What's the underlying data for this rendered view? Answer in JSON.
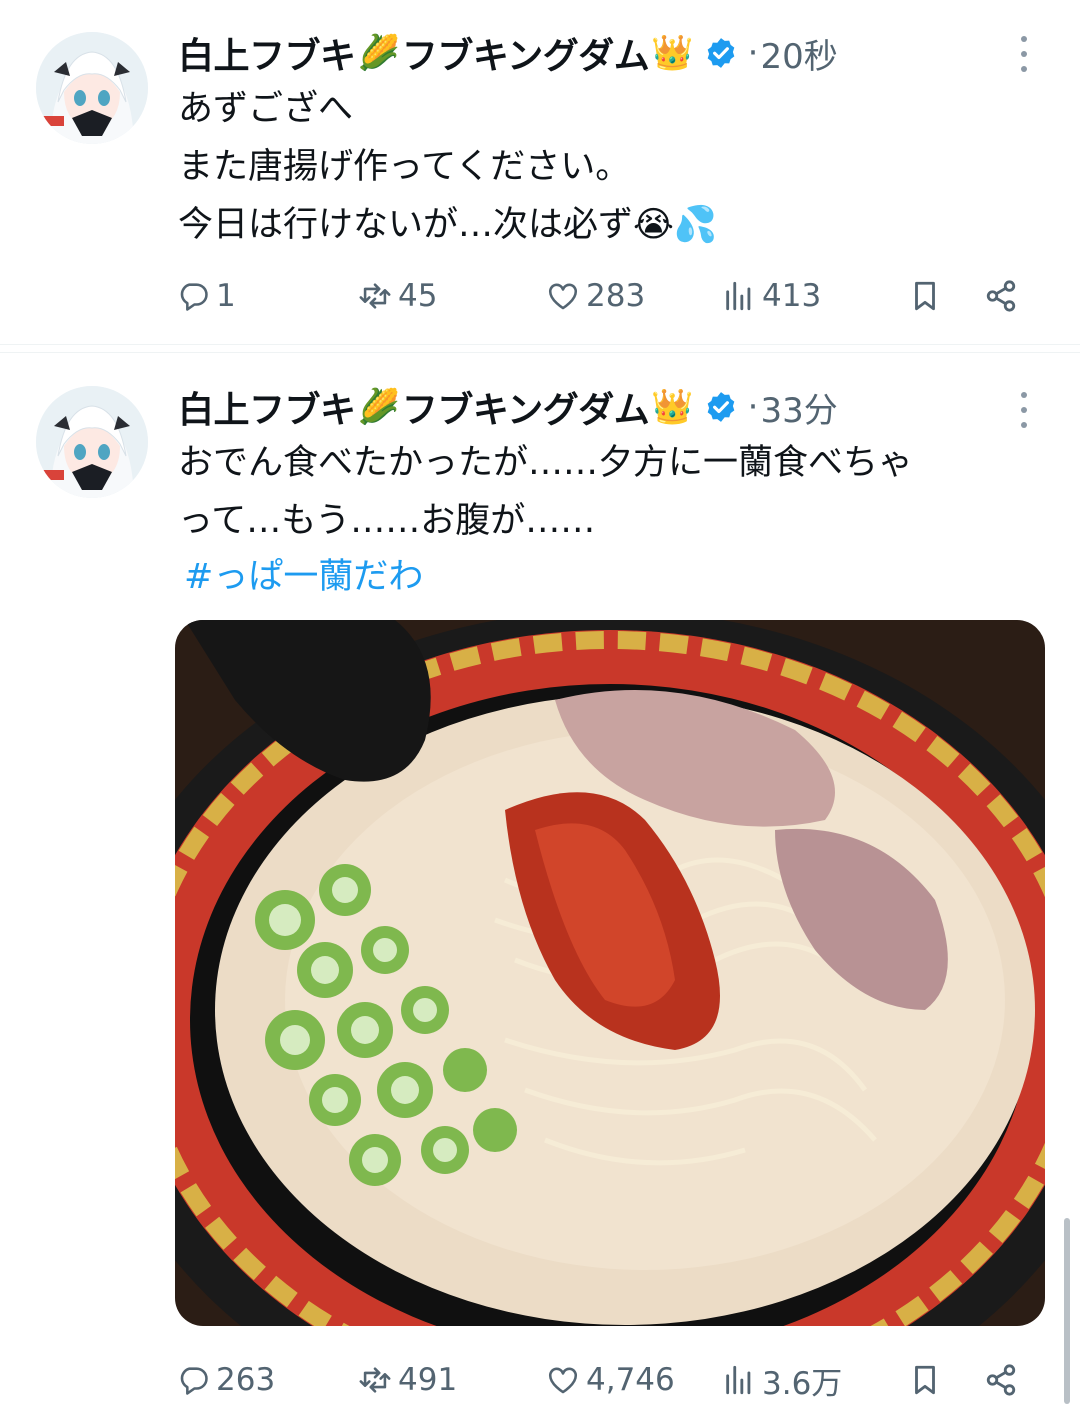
{
  "tweets": [
    {
      "author": "白上フブキ",
      "author_suffix": "フブキングダム",
      "emoji_corn": "🌽",
      "emoji_crown": "👑",
      "dot": "·",
      "time": "20秒",
      "text": "あずござへ\nまた唐揚げ作ってください。\n今日は行けないが…次は必ず😭💦",
      "replies": "1",
      "retweets": "45",
      "likes": "283",
      "views": "413"
    },
    {
      "author": "白上フブキ",
      "author_suffix": "フブキングダム",
      "emoji_corn": "🌽",
      "emoji_crown": "👑",
      "dot": "·",
      "time": "33分",
      "text": "おでん食べたかったが……夕方に一蘭食べちゃ\nって…もう……お腹が……",
      "hashtag": "#っぱ一蘭だわ",
      "replies": "263",
      "retweets": "491",
      "likes": "4,746",
      "views": "3.6万"
    }
  ],
  "icons": {
    "verified": "verified-badge-icon",
    "more": "more-icon",
    "reply": "reply-icon",
    "retweet": "retweet-icon",
    "like": "like-icon",
    "views": "views-icon",
    "bookmark": "bookmark-icon",
    "share": "share-icon"
  },
  "colors": {
    "accent": "#1d9bf0",
    "muted": "#536471",
    "text": "#0f1419"
  }
}
